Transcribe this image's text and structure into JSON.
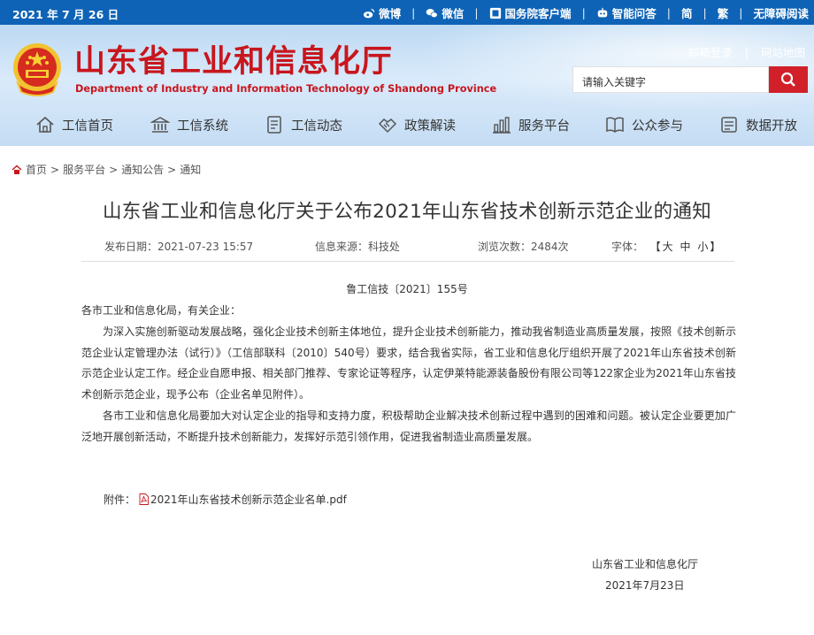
{
  "topbar": {
    "date": "2021 年 7 月 26 日",
    "links": [
      {
        "label": "微博",
        "icon": "weibo-icon"
      },
      {
        "label": "微信",
        "icon": "wechat-icon"
      },
      {
        "label": "国务院客户端",
        "icon": "state-council-app-icon"
      },
      {
        "label": "智能问答",
        "icon": "robot-icon"
      },
      {
        "label": "简"
      },
      {
        "label": "繁"
      },
      {
        "label": "无障碍阅读"
      }
    ]
  },
  "header": {
    "title": "山东省工业和信息化厅",
    "subtitle": "Department of Industry and Information Technology of Shandong Province",
    "mail_login": "邮箱登录",
    "site_map": "网站地图",
    "search_placeholder": "请输入关键字"
  },
  "nav": [
    {
      "label": "工信首页",
      "icon": "home-icon"
    },
    {
      "label": "工信系统",
      "icon": "building-icon"
    },
    {
      "label": "工信动态",
      "icon": "news-icon"
    },
    {
      "label": "政策解读",
      "icon": "handshake-icon"
    },
    {
      "label": "服务平台",
      "icon": "bar-chart-icon"
    },
    {
      "label": "公众参与",
      "icon": "book-icon"
    },
    {
      "label": "数据开放",
      "icon": "data-icon"
    }
  ],
  "breadcrumb": [
    "首页",
    "服务平台",
    "通知公告",
    "通知"
  ],
  "article": {
    "title": "山东省工业和信息化厅关于公布2021年山东省技术创新示范企业的通知",
    "publish_label": "发布日期：",
    "publish_date": "2021-07-23 15:57",
    "source_label": "信息来源：",
    "source": "科技处",
    "views_label": "浏览次数：",
    "views": "2484次",
    "font_label": "字体：",
    "font_sizes": [
      "大",
      "中",
      "小"
    ],
    "doc_number": "鲁工信技〔2021〕155号",
    "salutation": "各市工业和信息化局，有关企业：",
    "paragraphs": [
      "为深入实施创新驱动发展战略，强化企业技术创新主体地位，提升企业技术创新能力，推动我省制造业高质量发展，按照《技术创新示范企业认定管理办法（试行）》（工信部联科〔2010〕540号）要求，结合我省实际，省工业和信息化厅组织开展了2021年山东省技术创新示范企业认定工作。经企业自愿申报、相关部门推荐、专家论证等程序，认定伊莱特能源装备股份有限公司等122家企业为2021年山东省技术创新示范企业，现予公布（企业名单见附件）。",
      "各市工业和信息化局要加大对认定企业的指导和支持力度，积极帮助企业解决技术创新过程中遇到的困难和问题。被认定企业要更加广泛地开展创新活动，不断提升技术创新能力，发挥好示范引领作用，促进我省制造业高质量发展。"
    ],
    "attachment_label": "附件：",
    "attachment_file": "2021年山东省技术创新示范企业名单.pdf",
    "signer": "山东省工业和信息化厅",
    "sign_date": "2021年7月23日"
  },
  "colors": {
    "topbar_bg": "#0e63b6",
    "brand_red": "#c8161d",
    "search_btn": "#d2202a"
  }
}
